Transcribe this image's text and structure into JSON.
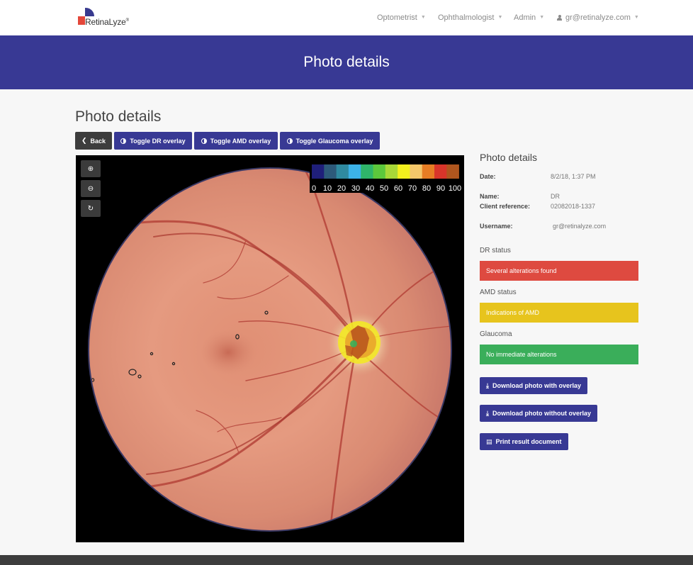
{
  "brand": {
    "name": "RetinaLyze",
    "mark": "®"
  },
  "nav": {
    "items": [
      {
        "label": "Optometrist"
      },
      {
        "label": "Ophthalmologist"
      },
      {
        "label": "Admin"
      }
    ],
    "user": "gr@retinalyze.com",
    "user_icon": "user-icon",
    "caret_icon": "caret-down-icon"
  },
  "hero": {
    "title": "Photo details"
  },
  "page": {
    "title": "Photo details"
  },
  "toolbar": {
    "back": "Back",
    "toggle_dr": "Toggle DR overlay",
    "toggle_amd": "Toggle AMD overlay",
    "toggle_glaucoma": "Toggle Glaucoma overlay"
  },
  "viewer": {
    "controls": [
      "zoom-in-icon",
      "zoom-out-icon",
      "reset-icon"
    ],
    "scale": {
      "labels": [
        "0",
        "10",
        "20",
        "30",
        "40",
        "50",
        "60",
        "70",
        "80",
        "90",
        "100"
      ],
      "colors": [
        "#1f1f7a",
        "#2d5a7a",
        "#2f8aa0",
        "#3cb2e8",
        "#2fb56a",
        "#5cc83c",
        "#a8d838",
        "#f3f01e",
        "#f5c76a",
        "#e77d24",
        "#d9352a",
        "#b0561e"
      ]
    }
  },
  "details": {
    "title": "Photo details",
    "date_label": "Date:",
    "date_value": "8/2/18, 1:37 PM",
    "name_label": "Name:",
    "name_value": "DR",
    "client_label": "Client reference:",
    "client_value": "02082018-1337",
    "username_label": "Username:",
    "username_value": "gr@retinalyze.com",
    "dr_label": "DR status",
    "dr_value": "Several alterations found",
    "dr_color": "#de4a40",
    "amd_label": "AMD status",
    "amd_value": "Indications of AMD",
    "amd_color": "#e7c41d",
    "glaucoma_label": "Glaucoma",
    "glaucoma_value": "No immediate alterations",
    "glaucoma_color": "#3aae5a",
    "download_with": "Download photo with overlay",
    "download_without": "Download photo without overlay",
    "print": "Print result document"
  }
}
